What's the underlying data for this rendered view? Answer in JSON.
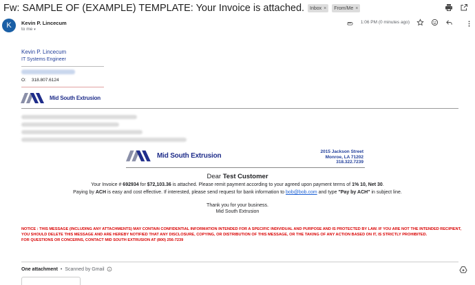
{
  "email": {
    "subject": "Fw: SAMPLE OF (EXAMPLE) TEMPLATE: Your Invoice is attached.",
    "labels": [
      {
        "text": "Inbox",
        "remove": "×"
      },
      {
        "text": "From/Me",
        "remove": "×"
      }
    ],
    "actions": {
      "print_icon": "print-icon",
      "open_icon": "open-in-new-window-icon"
    }
  },
  "sender": {
    "avatar_letter": "K",
    "name": "Kevin P. Lincecum",
    "to": "to me",
    "caret": "▾",
    "time": "1:06 PM (0 minutes ago)"
  },
  "signature": {
    "name": "Kevin P. Lincecum",
    "title": "IT Systems Engineer",
    "phone_label": "O:",
    "phone": "318.807.6124"
  },
  "company": {
    "name": "Mid South Extrusion",
    "brand_color": "#1f2d8a",
    "accent_color": "#1f3d99",
    "address_lines": [
      "2015 Jackson Street",
      "Monroe, LA 71202",
      "318.322.7239"
    ]
  },
  "invoice": {
    "dear_prefix": "Dear",
    "customer": "Test Customer",
    "line1_a": "Your Invoice #",
    "invoice_number": "692934",
    "line1_b": "for",
    "amount": "$72,103.36",
    "line1_c": "is attached. Please remit payment according to your agreed upon payment terms of",
    "terms": "1% 10, Net 30",
    "line1_d": ".",
    "line2_a": "Paying by",
    "ach": "ACH",
    "line2_b": "is easy and cost effective. If interested, please send request for bank information to",
    "bank_email": "bob@bob.com",
    "line2_c": "and type",
    "pay_by_ach": "\"Pay by ACH\"",
    "line2_d": "in subject line.",
    "thanks": "Thank you for your business.",
    "signoff": "Mid South Extrusion"
  },
  "notice": {
    "text": "NOTICE : THIS MESSAGE (INCLUDING ANY ATTACHMENTS) MAY CONTAIN CONFIDENTIAL INFORMATION INTENDED FOR A SPECIFIC INDIVIDUAL AND PURPOSE AND IS PROTECTED BY LAW. IF YOU ARE NOT THE INTENDED RECIPIENT, YOU SHOULD DELETE THIS MESSAGE AND ARE HEREBY NOTIFIED THAT ANY DISCLOSURE, COPYING, OR DISTRIBUTION OF THIS MESSAGE, OR THE TAKING OF ANY ACTION BASED ON IT, IS STRICTLY PROHIBITED.",
    "contact": "FOR QUESTIONS OR CONCERNS, CONTACT MID SOUTH EXTRUSION AT (800) 256-7239",
    "color": "#d90000"
  },
  "attachments": {
    "title": "One attachment",
    "separator": "•",
    "scanned": "Scanned by Gmail"
  }
}
